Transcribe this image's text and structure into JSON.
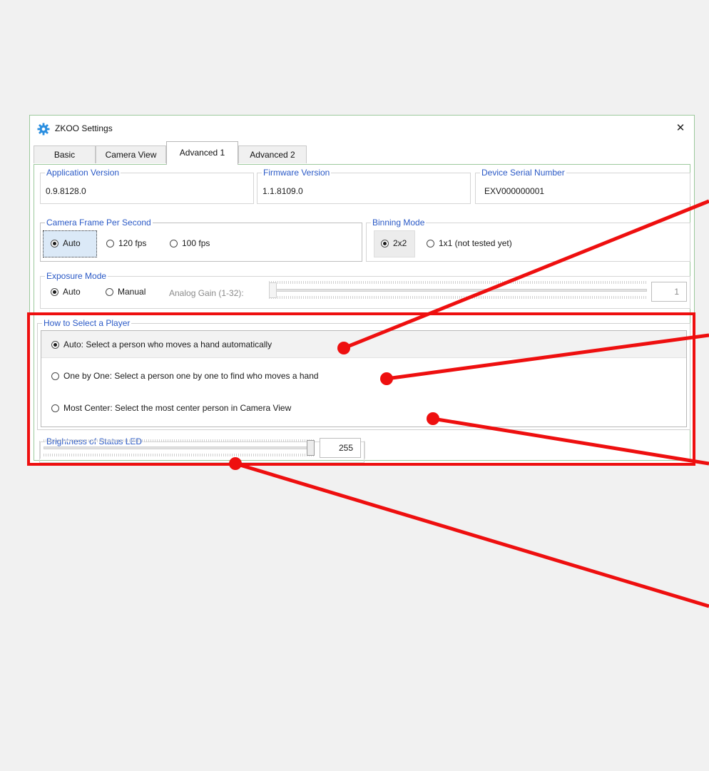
{
  "window": {
    "title": "ZKOO Settings",
    "close_label": "✕",
    "icon": "gear-icon"
  },
  "tabs": [
    {
      "label": "Basic",
      "active": false
    },
    {
      "label": "Camera View",
      "active": false
    },
    {
      "label": "Advanced 1",
      "active": true
    },
    {
      "label": "Advanced 2",
      "active": false
    }
  ],
  "info": {
    "app_version": {
      "title": "Application Version",
      "value": "0.9.8128.0"
    },
    "firmware_version": {
      "title": "Firmware Version",
      "value": "1.1.8109.0"
    },
    "serial_number": {
      "title": "Device Serial Number",
      "value": "EXV000000001"
    }
  },
  "fps": {
    "title": "Camera Frame Per Second",
    "options": [
      "Auto",
      "120 fps",
      "100 fps"
    ],
    "selected": "Auto"
  },
  "binning": {
    "title": "Binning Mode",
    "options": [
      "2x2",
      "1x1 (not tested yet)"
    ],
    "selected": "2x2"
  },
  "exposure": {
    "title": "Exposure Mode",
    "options": [
      "Auto",
      "Manual"
    ],
    "selected": "Auto",
    "gain_label": "Analog Gain (1-32):",
    "gain_value": "1",
    "gain_level": 0.0
  },
  "player": {
    "title": "How to Select a Player",
    "options": [
      "Auto: Select a person who moves a hand automatically",
      "One by One: Select a person one by one to find who moves a hand",
      "Most Center: Select the most center person in Camera View"
    ],
    "selected_index": 0
  },
  "led": {
    "title": "Brightness of Status LED",
    "value": "255",
    "level": 1.0
  },
  "colors": {
    "accent_title": "#2a59c6",
    "annotation": "#ee0f0f",
    "window_border": "#9cc99c"
  }
}
